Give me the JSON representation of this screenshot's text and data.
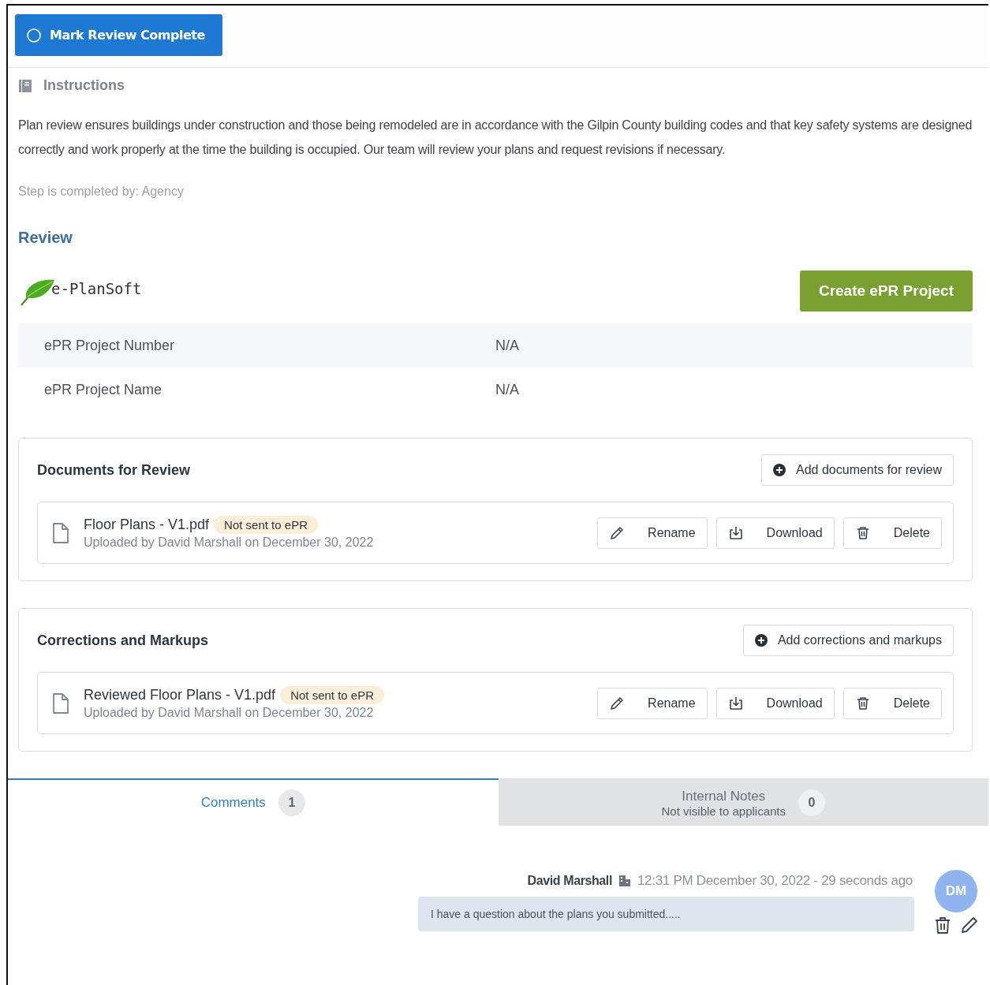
{
  "mark_complete": {
    "label": "Mark Review Complete",
    "checked": false
  },
  "instructions": {
    "heading": "Instructions",
    "text": "Plan review ensures buildings under construction and those being remodeled are in accordance with the Gilpin County building codes and that key safety systems are designed correctly and work properly at the time the building is occupied. Our team will review your plans and request revisions if necessary.",
    "completed_by": "Step is completed by: Agency"
  },
  "review": {
    "heading": "Review",
    "logo_text": "e-PlanSoft",
    "create_button": "Create ePR Project",
    "fields": [
      {
        "label": "ePR Project Number",
        "value": "N/A"
      },
      {
        "label": "ePR Project Name",
        "value": "N/A"
      }
    ]
  },
  "sections": [
    {
      "title": "Documents for Review",
      "add_button": "Add documents for review",
      "files": [
        {
          "name": "Floor Plans - V1.pdf",
          "status": "Not sent to ePR",
          "uploaded": "Uploaded by David Marshall on December 30, 2022",
          "actions": [
            {
              "kind": "rename",
              "label": "Rename"
            },
            {
              "kind": "download",
              "label": "Download"
            },
            {
              "kind": "delete",
              "label": "Delete"
            }
          ]
        }
      ]
    },
    {
      "title": "Corrections and Markups",
      "add_button": "Add corrections and markups",
      "files": [
        {
          "name": "Reviewed Floor Plans - V1.pdf",
          "status": "Not sent to ePR",
          "uploaded": "Uploaded by David Marshall on December 30, 2022",
          "actions": [
            {
              "kind": "rename",
              "label": "Rename"
            },
            {
              "kind": "download",
              "label": "Download"
            },
            {
              "kind": "delete",
              "label": "Delete"
            }
          ]
        }
      ]
    }
  ],
  "tabs": [
    {
      "label": "Comments",
      "count": "1",
      "selected": true
    },
    {
      "label": "Internal Notes",
      "sublabel": "Not visible to applicants",
      "count": "0",
      "selected": false
    }
  ],
  "comments": [
    {
      "author": "David Marshall",
      "time": "12:31 PM December 30, 2022 - 29 seconds ago",
      "text": "I have a question about the plans you submitted.....",
      "initials": "DM"
    }
  ]
}
